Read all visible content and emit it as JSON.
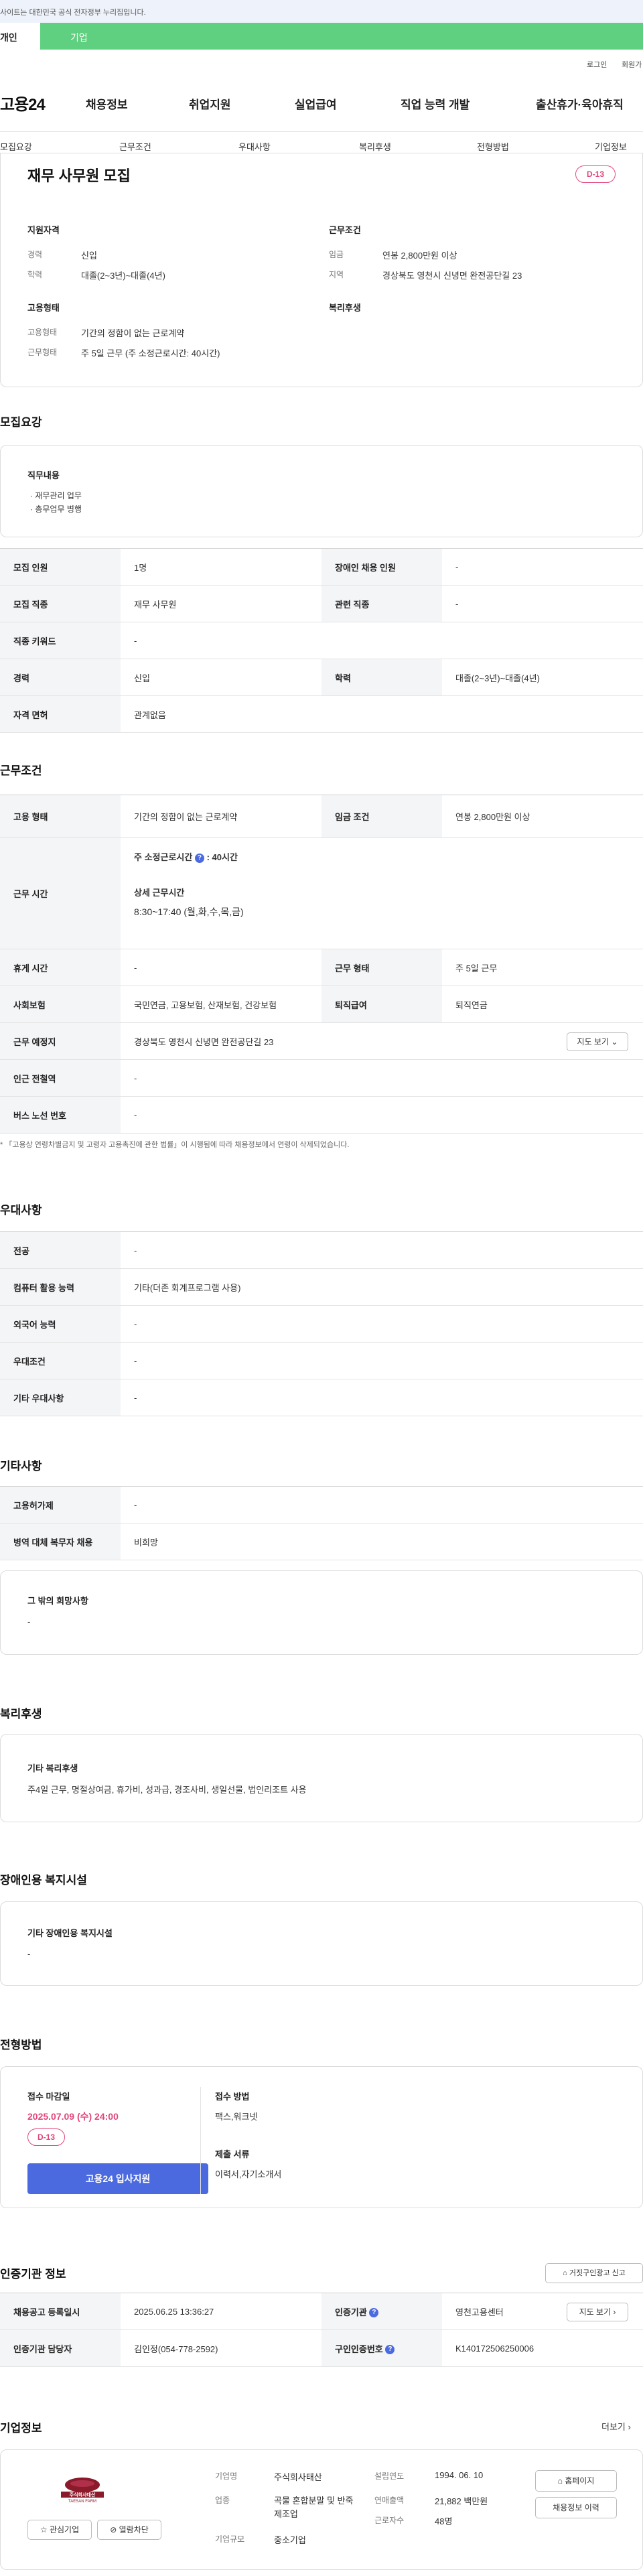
{
  "gov_bar": {
    "text": "사이트는 대한민국 공식 전자정부 누리집입니다."
  },
  "user_tabs": {
    "individual": "개인",
    "company": "기업"
  },
  "util_links": {
    "login": "로그인",
    "signup": "회원가"
  },
  "gnb": {
    "logo": "고용24",
    "items": [
      "채용정보",
      "취업지원",
      "실업급여",
      "직업 능력 개발",
      "출산휴가·육아휴직"
    ]
  },
  "subnav": {
    "items": [
      "모집요강",
      "근무조건",
      "우대사항",
      "복리후생",
      "전형방법",
      "기업정보"
    ]
  },
  "summary": {
    "title": "재무 사무원 모집",
    "dday": "D-13",
    "qual_title": "지원자격",
    "career_label": "경력",
    "career": "신입",
    "edu_label": "학력",
    "edu": "대졸(2~3년)~대졸(4년)",
    "emp_title": "고용형태",
    "emp_label": "고용형태",
    "emp": "기간의 정함이 없는 근로계약",
    "work_label": "근무형태",
    "work": "주 5일 근무 (주 소정근로시간: 40시간)",
    "cond_title": "근무조건",
    "wage_label": "임금",
    "wage": "연봉 2,800만원 이상",
    "region_label": "지역",
    "region": "경상북도 영천시 신녕면 완전공단길 23",
    "welfare_title": "복리후생"
  },
  "recruit": {
    "section": "모집요강",
    "duty_title": "직무내용",
    "duties": [
      "· 재무관리 업무",
      "· 총무업무 병행"
    ],
    "rows": {
      "count_label": "모집 인원",
      "count": "1명",
      "disabled_label": "장애인 채용 인원",
      "disabled": "-",
      "job_label": "모집 직종",
      "job": "재무 사무원",
      "rel_label": "관련 직종",
      "rel": "-",
      "kw_label": "직종 키워드",
      "kw": "-",
      "career_label": "경력",
      "career": "신입",
      "edu_label": "학력",
      "edu": "대졸(2~3년)~대졸(4년)",
      "license_label": "자격 면허",
      "license": "관계없음"
    }
  },
  "cond": {
    "section": "근무조건",
    "emp_label": "고용 형태",
    "emp": "기간의 정함이 없는 근로계약",
    "wage_label": "임금 조건",
    "wage": "연봉 2,800만원 이상",
    "time_label": "근무 시간",
    "weekly": "주 소정근로시간",
    "weekly_val": ": 40시간",
    "detail_title": "상세 근무시간",
    "detail": "8:30~17:40 (월,화,수,목,금)",
    "rest_label": "휴게 시간",
    "rest": "-",
    "form_label": "근무 형태",
    "form": "주 5일 근무",
    "ins_label": "사회보험",
    "ins": "국민연금, 고용보험, 산재보험, 건강보험",
    "retire_label": "퇴직급여",
    "retire": "퇴직연금",
    "place_label": "근무 예정지",
    "place": "경상북도 영천시 신녕면 완전공단길 23",
    "map_btn": "지도 보기",
    "subway_label": "인근 전철역",
    "subway": "-",
    "bus_label": "버스 노선 번호",
    "bus": "-",
    "note": "* 「고용상 연령차별금지 및 고령자 고용촉진에 관한 법률」이 시행됨에 따라 채용정보에서 연령이 삭제되었습니다."
  },
  "pref": {
    "section": "우대사항",
    "major_label": "전공",
    "major": "-",
    "pc_label": "컴퓨터 활용 능력",
    "pc": "기타(더존 회계프로그램 사용)",
    "lang_label": "외국어 능력",
    "lang": "-",
    "cond_label": "우대조건",
    "cond": "-",
    "etc_label": "기타 우대사항",
    "etc": "-"
  },
  "etc": {
    "section": "기타사항",
    "permit_label": "고용허가제",
    "permit": "-",
    "military_label": "병역 대체 복무자 채용",
    "military": "비희망",
    "other_title": "그 밖의 희망사항",
    "other": "-"
  },
  "welfare": {
    "section": "복리후생",
    "title": "기타 복리후생",
    "text": "주4일 근무, 명절상여금, 휴가비, 성과급, 경조사비, 생일선물, 법인리조트 사용"
  },
  "disabled_fac": {
    "section": "장애인용 복지시설",
    "title": "기타 장애인용 복지시설",
    "text": "-"
  },
  "process": {
    "section": "전형방법",
    "deadline_title": "접수 마감일",
    "deadline": "2025.07.09 (수) 24:00",
    "dday": "D-13",
    "apply_btn": "고용24 입사지원",
    "method_title": "접수 방법",
    "method": "팩스,워크넷",
    "docs_title": "제출 서류",
    "docs": "이력서,자기소개서"
  },
  "agency": {
    "section": "인증기관 정보",
    "report_btn": "거짓구인광고 신고",
    "reg_label": "채용공고 등록일시",
    "reg": "2025.06.25 13:36:27",
    "org_label": "인증기관",
    "org": "영천고용센터",
    "map_btn": "지도 보기",
    "mgr_label": "인증기관 담당자",
    "mgr": "김인정(054-778-2592)",
    "num_label": "구인인증번호",
    "num": "K140172506250006"
  },
  "company": {
    "section": "기업정보",
    "more": "더보기",
    "logo_text": "주식회사태산",
    "logo_sub": "TAESAN FARM",
    "fav_btn": "관심기업",
    "block_btn": "열람차단",
    "name_label": "기업명",
    "name": "주식회사태산",
    "biz_label": "업종",
    "biz": "곡물 혼합분말 및 반죽 제조업",
    "size_label": "기업규모",
    "size": "중소기업",
    "est_label": "설립연도",
    "est": "1994. 06. 10",
    "sales_label": "연매출액",
    "sales": "21,882 백만원",
    "emp_label": "근로자수",
    "emp": "48명",
    "home_btn": "홈페이지",
    "jobs_btn": "채용정보 이력"
  }
}
